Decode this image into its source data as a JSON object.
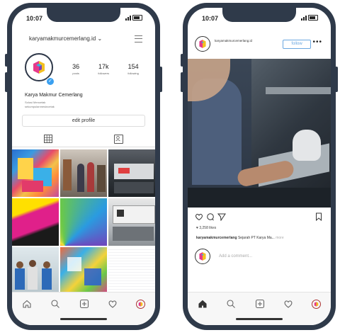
{
  "status_bar": {
    "time": "10:07"
  },
  "profile": {
    "username": "karyamakmurcemerlang.id",
    "stats": [
      {
        "value": "36",
        "label": "posts"
      },
      {
        "value": "17k",
        "label": "followers"
      },
      {
        "value": "154",
        "label": "following"
      }
    ],
    "name": "Karya Makmur Cemerlang",
    "bio_lines": [
      "Solusi Mencetak",
      "sekumpulanmesincetak"
    ],
    "edit_profile_label": "edit profile"
  },
  "post": {
    "username": "karyamakmurcemerlang.id",
    "follow_label": "follow",
    "likes": "3,258 likes",
    "caption_user": "karyamakmurcemerlang",
    "caption_text": "Sejarah PT Karya Ma...",
    "caption_more": "more",
    "comment_placeholder": "Add a comment..."
  },
  "colors": {
    "phone_frame": "#2f3a4a",
    "follow_blue": "#6aa7e0",
    "verified_blue": "#3aa0f0"
  },
  "icons": {
    "nav": [
      "home-icon",
      "search-icon",
      "add-post-icon",
      "heart-icon",
      "profile-avatar-icon"
    ],
    "post_actions": [
      "heart-icon",
      "comment-icon",
      "share-icon",
      "bookmark-icon"
    ]
  }
}
